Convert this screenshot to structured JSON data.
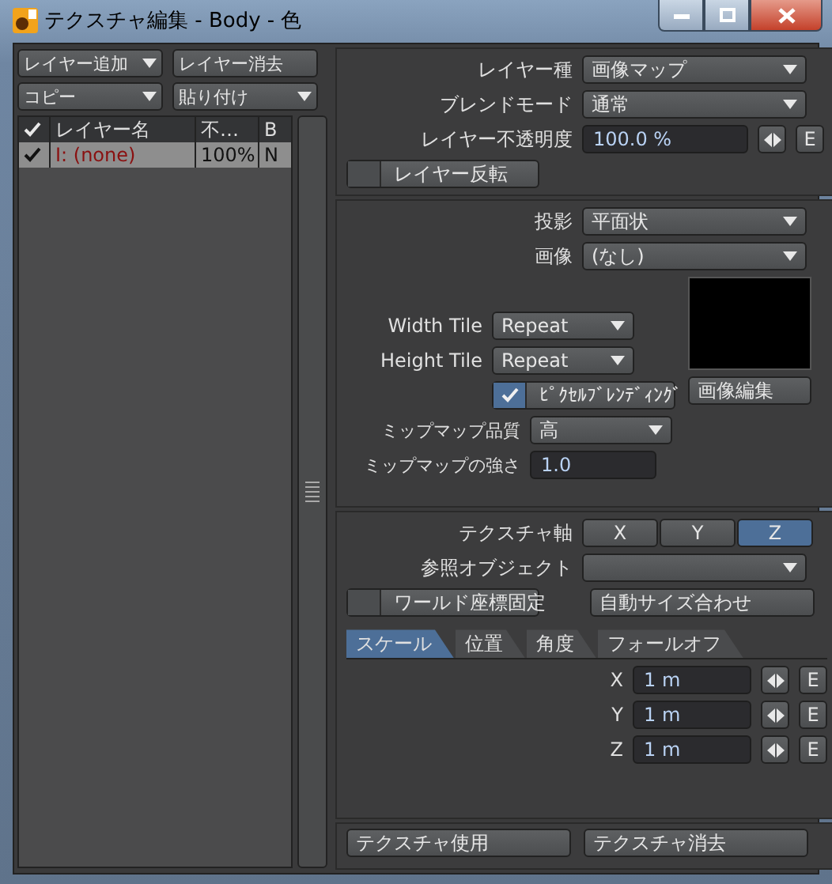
{
  "window": {
    "title": "テクスチャ編集 - Body - 色"
  },
  "layer_buttons": [
    {
      "label": "レイヤー追加",
      "dropdown": true
    },
    {
      "label": "レイヤー消去",
      "dropdown": false
    },
    {
      "label": "コピー",
      "dropdown": true
    },
    {
      "label": "貼り付け",
      "dropdown": true
    }
  ],
  "layer_table": {
    "columns": [
      "レイヤー名",
      "不…",
      "B"
    ],
    "rows": [
      {
        "enabled": true,
        "selected": true,
        "name": "I: (none)",
        "opacity": "100%",
        "blend": "N"
      }
    ]
  },
  "layer_settings": [
    {
      "kind": "dropdown",
      "label": "レイヤー種",
      "value": "画像マップ"
    },
    {
      "kind": "dropdown",
      "label": "ブレンドモード",
      "value": "通常"
    },
    {
      "kind": "number",
      "label": "レイヤー不透明度",
      "value": "100.0 %",
      "envelope": "E"
    }
  ],
  "invert": {
    "label": "レイヤー反転",
    "checked": false
  },
  "projection": [
    {
      "label": "投影",
      "value": "平面状"
    },
    {
      "label": "画像",
      "value": "(なし)"
    }
  ],
  "tiles": [
    {
      "label": "Width Tile",
      "value": "Repeat"
    },
    {
      "label": "Height Tile",
      "value": "Repeat"
    }
  ],
  "pixel_blending": {
    "label": "ﾋﾟｸｾﾙﾌﾞﾚﾝﾃﾞｨﾝｸﾞ",
    "checked": true
  },
  "edit_image": "画像編集",
  "mipmap_quality": {
    "label": "ミップマップ品質",
    "value": "高"
  },
  "mipmap_strength": {
    "label": "ミップマップの強さ",
    "value": "1.0"
  },
  "axis": {
    "label": "テクスチャ軸",
    "options": [
      {
        "label": "X",
        "selected": false
      },
      {
        "label": "Y",
        "selected": false
      },
      {
        "label": "Z",
        "selected": true
      }
    ]
  },
  "reference_object": {
    "label": "参照オブジェクト"
  },
  "world_coords": {
    "label": "ワールド座標固定",
    "checked": false
  },
  "auto_size": "自動サイズ合わせ",
  "tabs": [
    {
      "label": "スケール",
      "selected": true
    },
    {
      "label": "位置",
      "selected": false
    },
    {
      "label": "角度",
      "selected": false
    },
    {
      "label": "フォールオフ",
      "selected": false
    }
  ],
  "scale_fields": [
    {
      "axis": "X",
      "value": "1 m",
      "envelope": "E"
    },
    {
      "axis": "Y",
      "value": "1 m",
      "envelope": "E"
    },
    {
      "axis": "Z",
      "value": "1 m",
      "envelope": "E"
    }
  ],
  "footer_buttons": [
    "テクスチャ使用",
    "テクスチャ消去"
  ]
}
